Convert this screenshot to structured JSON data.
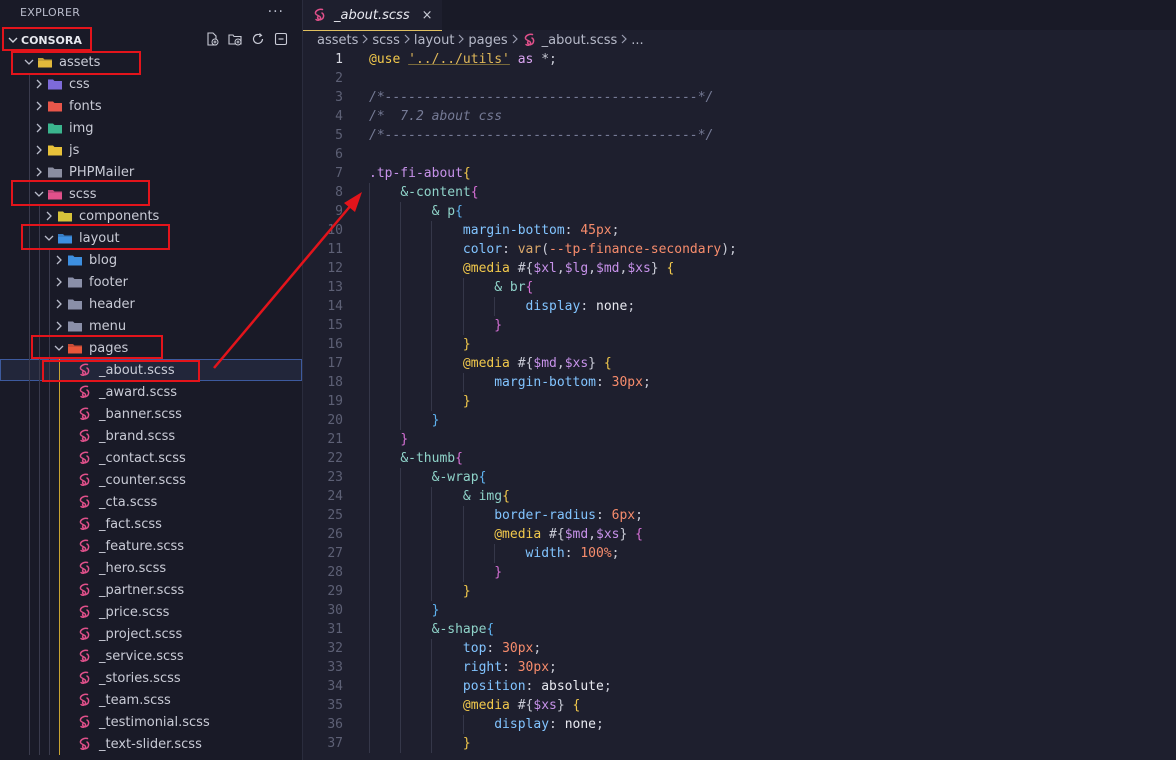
{
  "sidebar": {
    "header_title": "EXPLORER",
    "header_more": "···",
    "root_name": "CONSORA",
    "tree": [
      {
        "label": "assets",
        "type": "folder-open",
        "indent": 0,
        "icon": "assets-folder-icon",
        "color": "#e2b93b"
      },
      {
        "label": "css",
        "type": "folder",
        "indent": 1,
        "icon": "css-folder-icon",
        "color": "#7d6ad9"
      },
      {
        "label": "fonts",
        "type": "folder",
        "indent": 1,
        "icon": "fonts-folder-icon",
        "color": "#e8564a"
      },
      {
        "label": "img",
        "type": "folder",
        "indent": 1,
        "icon": "image-folder-icon",
        "color": "#3bb58e"
      },
      {
        "label": "js",
        "type": "folder",
        "indent": 1,
        "icon": "js-folder-icon",
        "color": "#e8c23a"
      },
      {
        "label": "PHPMailer",
        "type": "folder",
        "indent": 1,
        "icon": "php-folder-icon",
        "color": "#8a8da0"
      },
      {
        "label": "scss",
        "type": "folder-open",
        "indent": 1,
        "icon": "scss-folder-icon",
        "color": "#e0508a"
      },
      {
        "label": "components",
        "type": "folder",
        "indent": 2,
        "icon": "components-folder-icon",
        "color": "#d6c33a"
      },
      {
        "label": "layout",
        "type": "folder-open",
        "indent": 2,
        "icon": "layout-folder-icon",
        "color": "#3d8fe0"
      },
      {
        "label": "blog",
        "type": "folder",
        "indent": 3,
        "icon": "blog-folder-icon",
        "color": "#3d8fe0"
      },
      {
        "label": "footer",
        "type": "folder",
        "indent": 3,
        "icon": "folder-icon",
        "color": "#8a8fa8"
      },
      {
        "label": "header",
        "type": "folder",
        "indent": 3,
        "icon": "folder-icon",
        "color": "#8a8fa8"
      },
      {
        "label": "menu",
        "type": "folder",
        "indent": 3,
        "icon": "folder-icon",
        "color": "#8a8fa8"
      },
      {
        "label": "pages",
        "type": "folder-open",
        "indent": 3,
        "icon": "pages-folder-icon",
        "color": "#e8563a"
      },
      {
        "label": "_about.scss",
        "type": "file",
        "indent": 4,
        "icon": "sass-file-icon",
        "selected": true
      },
      {
        "label": "_award.scss",
        "type": "file",
        "indent": 4,
        "icon": "sass-file-icon"
      },
      {
        "label": "_banner.scss",
        "type": "file",
        "indent": 4,
        "icon": "sass-file-icon"
      },
      {
        "label": "_brand.scss",
        "type": "file",
        "indent": 4,
        "icon": "sass-file-icon"
      },
      {
        "label": "_contact.scss",
        "type": "file",
        "indent": 4,
        "icon": "sass-file-icon"
      },
      {
        "label": "_counter.scss",
        "type": "file",
        "indent": 4,
        "icon": "sass-file-icon"
      },
      {
        "label": "_cta.scss",
        "type": "file",
        "indent": 4,
        "icon": "sass-file-icon"
      },
      {
        "label": "_fact.scss",
        "type": "file",
        "indent": 4,
        "icon": "sass-file-icon"
      },
      {
        "label": "_feature.scss",
        "type": "file",
        "indent": 4,
        "icon": "sass-file-icon"
      },
      {
        "label": "_hero.scss",
        "type": "file",
        "indent": 4,
        "icon": "sass-file-icon"
      },
      {
        "label": "_partner.scss",
        "type": "file",
        "indent": 4,
        "icon": "sass-file-icon"
      },
      {
        "label": "_price.scss",
        "type": "file",
        "indent": 4,
        "icon": "sass-file-icon"
      },
      {
        "label": "_project.scss",
        "type": "file",
        "indent": 4,
        "icon": "sass-file-icon"
      },
      {
        "label": "_service.scss",
        "type": "file",
        "indent": 4,
        "icon": "sass-file-icon"
      },
      {
        "label": "_stories.scss",
        "type": "file",
        "indent": 4,
        "icon": "sass-file-icon"
      },
      {
        "label": "_team.scss",
        "type": "file",
        "indent": 4,
        "icon": "sass-file-icon"
      },
      {
        "label": "_testimonial.scss",
        "type": "file",
        "indent": 4,
        "icon": "sass-file-icon"
      },
      {
        "label": "_text-slider.scss",
        "type": "file",
        "indent": 4,
        "icon": "sass-file-icon"
      }
    ]
  },
  "editor": {
    "tab_label": "_about.scss",
    "tab_close": "×",
    "breadcrumbs": [
      "assets",
      "scss",
      "layout",
      "pages",
      "_about.scss",
      "..."
    ],
    "current_line": 1,
    "lines": [
      {
        "n": 1,
        "indent": 0,
        "tokens": [
          [
            "at",
            "@use"
          ],
          [
            "punc",
            " "
          ],
          [
            "str",
            "'../../utils'"
          ],
          [
            "punc",
            " "
          ],
          [
            "kw",
            "as"
          ],
          [
            "punc",
            " *;"
          ]
        ]
      },
      {
        "n": 2,
        "indent": 0,
        "tokens": []
      },
      {
        "n": 3,
        "indent": 0,
        "tokens": [
          [
            "com",
            "/*----------------------------------------*/"
          ]
        ]
      },
      {
        "n": 4,
        "indent": 0,
        "tokens": [
          [
            "com",
            "/*  7.2 about css"
          ]
        ]
      },
      {
        "n": 5,
        "indent": 0,
        "tokens": [
          [
            "com",
            "/*----------------------------------------*/"
          ]
        ]
      },
      {
        "n": 6,
        "indent": 0,
        "tokens": []
      },
      {
        "n": 7,
        "indent": 0,
        "tokens": [
          [
            "sel",
            ".tp-fi-about"
          ],
          [
            "brace",
            "{"
          ]
        ]
      },
      {
        "n": 8,
        "indent": 1,
        "tokens": [
          [
            "sel2",
            "&-content"
          ],
          [
            "brace2",
            "{"
          ]
        ]
      },
      {
        "n": 9,
        "indent": 2,
        "tokens": [
          [
            "sel2",
            "& p"
          ],
          [
            "brace3",
            "{"
          ]
        ]
      },
      {
        "n": 10,
        "indent": 3,
        "tokens": [
          [
            "prop",
            "margin-bottom"
          ],
          [
            "punc",
            ": "
          ],
          [
            "num",
            "45px"
          ],
          [
            "punc",
            ";"
          ]
        ]
      },
      {
        "n": 11,
        "indent": 3,
        "tokens": [
          [
            "prop",
            "color"
          ],
          [
            "punc",
            ": "
          ],
          [
            "func",
            "var"
          ],
          [
            "punc",
            "("
          ],
          [
            "num",
            "--tp-finance-secondary"
          ],
          [
            "punc",
            ");"
          ]
        ]
      },
      {
        "n": 12,
        "indent": 3,
        "tokens": [
          [
            "at",
            "@media"
          ],
          [
            "punc",
            " #{"
          ],
          [
            "var",
            "$xl"
          ],
          [
            "punc",
            ","
          ],
          [
            "var",
            "$lg"
          ],
          [
            "punc",
            ","
          ],
          [
            "var",
            "$md"
          ],
          [
            "punc",
            ","
          ],
          [
            "var",
            "$xs"
          ],
          [
            "punc",
            "} "
          ],
          [
            "brace",
            "{"
          ]
        ]
      },
      {
        "n": 13,
        "indent": 4,
        "tokens": [
          [
            "sel2",
            "& br"
          ],
          [
            "brace2",
            "{"
          ]
        ]
      },
      {
        "n": 14,
        "indent": 5,
        "tokens": [
          [
            "prop",
            "display"
          ],
          [
            "punc",
            ": "
          ],
          [
            "val",
            "none"
          ],
          [
            "punc",
            ";"
          ]
        ]
      },
      {
        "n": 15,
        "indent": 4,
        "tokens": [
          [
            "brace2",
            "}"
          ]
        ]
      },
      {
        "n": 16,
        "indent": 3,
        "tokens": [
          [
            "brace",
            "}"
          ]
        ]
      },
      {
        "n": 17,
        "indent": 3,
        "tokens": [
          [
            "at",
            "@media"
          ],
          [
            "punc",
            " #{"
          ],
          [
            "var",
            "$md"
          ],
          [
            "punc",
            ","
          ],
          [
            "var",
            "$xs"
          ],
          [
            "punc",
            "} "
          ],
          [
            "brace",
            "{"
          ]
        ]
      },
      {
        "n": 18,
        "indent": 4,
        "tokens": [
          [
            "prop",
            "margin-bottom"
          ],
          [
            "punc",
            ": "
          ],
          [
            "num",
            "30px"
          ],
          [
            "punc",
            ";"
          ]
        ]
      },
      {
        "n": 19,
        "indent": 3,
        "tokens": [
          [
            "brace",
            "}"
          ]
        ]
      },
      {
        "n": 20,
        "indent": 2,
        "tokens": [
          [
            "brace3",
            "}"
          ]
        ]
      },
      {
        "n": 21,
        "indent": 1,
        "tokens": [
          [
            "brace2",
            "}"
          ]
        ]
      },
      {
        "n": 22,
        "indent": 1,
        "tokens": [
          [
            "sel2",
            "&-thumb"
          ],
          [
            "brace2",
            "{"
          ]
        ]
      },
      {
        "n": 23,
        "indent": 2,
        "tokens": [
          [
            "sel2",
            "&-wrap"
          ],
          [
            "brace3",
            "{"
          ]
        ]
      },
      {
        "n": 24,
        "indent": 3,
        "tokens": [
          [
            "sel2",
            "& img"
          ],
          [
            "brace",
            "{"
          ]
        ]
      },
      {
        "n": 25,
        "indent": 4,
        "tokens": [
          [
            "prop",
            "border-radius"
          ],
          [
            "punc",
            ": "
          ],
          [
            "num",
            "6px"
          ],
          [
            "punc",
            ";"
          ]
        ]
      },
      {
        "n": 26,
        "indent": 4,
        "tokens": [
          [
            "at",
            "@media"
          ],
          [
            "punc",
            " #{"
          ],
          [
            "var",
            "$md"
          ],
          [
            "punc",
            ","
          ],
          [
            "var",
            "$xs"
          ],
          [
            "punc",
            "} "
          ],
          [
            "brace2",
            "{"
          ]
        ]
      },
      {
        "n": 27,
        "indent": 5,
        "tokens": [
          [
            "prop",
            "width"
          ],
          [
            "punc",
            ": "
          ],
          [
            "num",
            "100%"
          ],
          [
            "punc",
            ";"
          ]
        ]
      },
      {
        "n": 28,
        "indent": 4,
        "tokens": [
          [
            "brace2",
            "}"
          ]
        ]
      },
      {
        "n": 29,
        "indent": 3,
        "tokens": [
          [
            "brace",
            "}"
          ]
        ]
      },
      {
        "n": 30,
        "indent": 2,
        "tokens": [
          [
            "brace3",
            "}"
          ]
        ]
      },
      {
        "n": 31,
        "indent": 2,
        "tokens": [
          [
            "sel2",
            "&-shape"
          ],
          [
            "brace3",
            "{"
          ]
        ]
      },
      {
        "n": 32,
        "indent": 3,
        "tokens": [
          [
            "prop",
            "top"
          ],
          [
            "punc",
            ": "
          ],
          [
            "num",
            "30px"
          ],
          [
            "punc",
            ";"
          ]
        ]
      },
      {
        "n": 33,
        "indent": 3,
        "tokens": [
          [
            "prop",
            "right"
          ],
          [
            "punc",
            ": "
          ],
          [
            "num",
            "30px"
          ],
          [
            "punc",
            ";"
          ]
        ]
      },
      {
        "n": 34,
        "indent": 3,
        "tokens": [
          [
            "prop",
            "position"
          ],
          [
            "punc",
            ": "
          ],
          [
            "val",
            "absolute"
          ],
          [
            "punc",
            ";"
          ]
        ]
      },
      {
        "n": 35,
        "indent": 3,
        "tokens": [
          [
            "at",
            "@media"
          ],
          [
            "punc",
            " #{"
          ],
          [
            "var",
            "$xs"
          ],
          [
            "punc",
            "} "
          ],
          [
            "brace",
            "{"
          ]
        ]
      },
      {
        "n": 36,
        "indent": 4,
        "tokens": [
          [
            "prop",
            "display"
          ],
          [
            "punc",
            ": "
          ],
          [
            "val",
            "none"
          ],
          [
            "punc",
            ";"
          ]
        ]
      },
      {
        "n": 37,
        "indent": 3,
        "tokens": [
          [
            "brace",
            "}"
          ]
        ]
      }
    ]
  },
  "colors": {
    "accent_red": "#e3141b",
    "sass_pink": "#e0508a"
  }
}
